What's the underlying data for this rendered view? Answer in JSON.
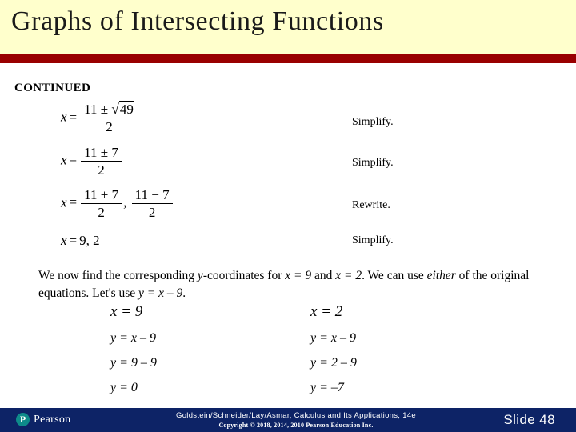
{
  "colors": {
    "header_bg": "#FFFFCC",
    "header_rule": "#990000",
    "footer_bg": "#0D2366",
    "pearson_mark": "#0E8A8A",
    "body_bg": "#FFFFFF",
    "text": "#000000"
  },
  "header": {
    "title": "Graphs of Intersecting Functions"
  },
  "body": {
    "continued_label": "CONTINUED",
    "derivation": [
      {
        "math_text": "x = (11 ± √49) / 2",
        "lhs": "x",
        "eq": "=",
        "numerator_prefix": "11 ± ",
        "radicand": "49",
        "denominator": "2",
        "note": "Simplify."
      },
      {
        "math_text": "x = (11 ± 7) / 2",
        "lhs": "x",
        "eq": "=",
        "numerator": "11 ± 7",
        "denominator": "2",
        "note": "Simplify."
      },
      {
        "math_text": "x = (11 + 7) / 2 ,  (11 − 7) / 2",
        "lhs": "x",
        "eq": "=",
        "numerator_1": "11 + 7",
        "denominator_1": "2",
        "separator": ",",
        "numerator_2": "11 − 7",
        "denominator_2": "2",
        "note": "Rewrite."
      },
      {
        "math_text": "x = 9,  2",
        "lhs": "x",
        "eq": "=",
        "values": "9,  2",
        "note": "Simplify."
      }
    ],
    "explanation": {
      "part_1": "We now find the corresponding ",
      "var_y": "y",
      "part_2": "-coordinates for ",
      "cond_1": "x = 9",
      "part_3": " and ",
      "cond_2": "x = 2",
      "part_4": ".  We can use ",
      "emphasis": "either",
      "part_5": " of the original equations.  Let's use ",
      "equation": "y = x – 9",
      "part_6": "."
    },
    "cases": [
      {
        "heading": "x = 9",
        "lines": [
          "y = x – 9",
          "y = 9 – 9",
          "y = 0"
        ]
      },
      {
        "heading": "x = 2",
        "lines": [
          "y = x – 9",
          "y = 2 – 9",
          "y = –7"
        ]
      }
    ]
  },
  "footer": {
    "brand_mark": "P",
    "brand_name": "Pearson",
    "citation": "Goldstein/Schneider/Lay/Asmar, Calculus and Its Applications, 14e",
    "copyright": "Copyright © 2018, 2014, 2010 Pearson Education Inc.",
    "slide_number": "Slide 48"
  }
}
